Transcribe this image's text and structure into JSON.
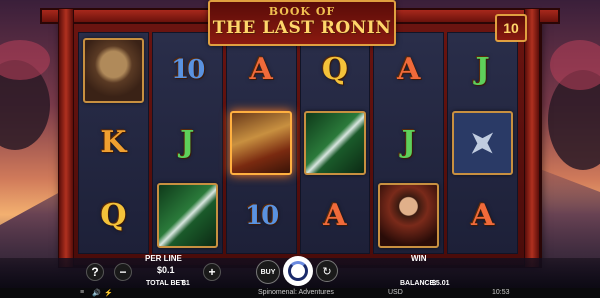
{
  "title": {
    "line1": "BOOK OF",
    "line2": "THE LAST RONIN"
  },
  "lines_count": "10",
  "reels": [
    [
      {
        "type": "pic",
        "name": "helmet"
      },
      {
        "type": "letter",
        "value": "K",
        "cls": "K"
      },
      {
        "type": "letter",
        "value": "Q",
        "cls": "Q"
      }
    ],
    [
      {
        "type": "letter",
        "value": "10",
        "cls": "10"
      },
      {
        "type": "letter",
        "value": "J",
        "cls": "J"
      },
      {
        "type": "pic",
        "name": "sword"
      }
    ],
    [
      {
        "type": "letter",
        "value": "A",
        "cls": "A"
      },
      {
        "type": "pic",
        "name": "book"
      },
      {
        "type": "letter",
        "value": "10",
        "cls": "10"
      }
    ],
    [
      {
        "type": "letter",
        "value": "Q",
        "cls": "Q"
      },
      {
        "type": "pic",
        "name": "sword"
      },
      {
        "type": "letter",
        "value": "A",
        "cls": "A"
      }
    ],
    [
      {
        "type": "letter",
        "value": "A",
        "cls": "A"
      },
      {
        "type": "letter",
        "value": "J",
        "cls": "J"
      },
      {
        "type": "pic",
        "name": "warrior"
      }
    ],
    [
      {
        "type": "letter",
        "value": "J",
        "cls": "J"
      },
      {
        "type": "pic",
        "name": "shuriken"
      },
      {
        "type": "letter",
        "value": "A",
        "cls": "A"
      }
    ]
  ],
  "hud": {
    "help_label": "?",
    "minus_label": "−",
    "plus_label": "+",
    "per_line_label": "PER LINE",
    "per_line_value": "$0.1",
    "total_bet_label": "TOTAL BET:",
    "total_bet_value": "$1",
    "buy_label": "BUY",
    "auto_label": "↻",
    "win_label": "WIN",
    "balance_label": "BALANCE:",
    "balance_value": "$5.01"
  },
  "footer": {
    "menu_icon": "≡",
    "sound_icon": "🔊",
    "turbo_icon": "⚡",
    "provider": "Spinomenal: Adventures",
    "currency": "USD",
    "time": "10:53"
  },
  "colors": {
    "frame": "#6b1410",
    "gold": "#e0a040",
    "reel_bg": "#2a2e4a"
  }
}
